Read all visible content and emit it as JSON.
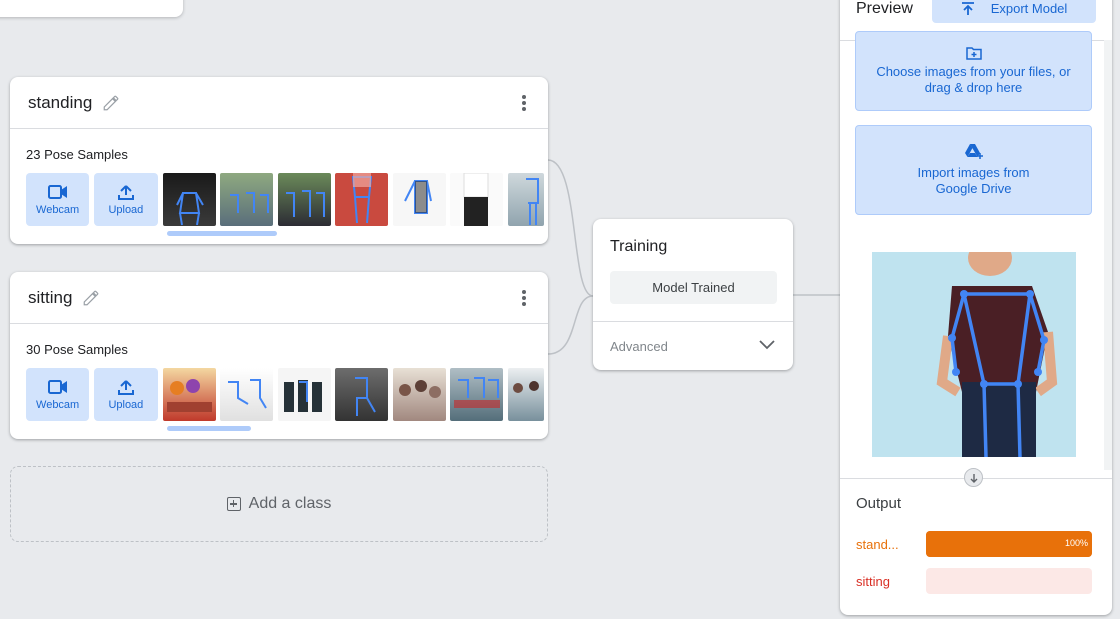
{
  "classes": [
    {
      "name": "standing",
      "samples_label": "23 Pose Samples",
      "webcam_label": "Webcam",
      "upload_label": "Upload"
    },
    {
      "name": "sitting",
      "samples_label": "30 Pose Samples",
      "webcam_label": "Webcam",
      "upload_label": "Upload"
    }
  ],
  "add_class_label": "Add a class",
  "training": {
    "title": "Training",
    "status_button": "Model Trained",
    "advanced_label": "Advanced"
  },
  "preview": {
    "title": "Preview",
    "export_label": "Export Model",
    "choose_files_text": "Choose images from your files, or drag & drop here",
    "import_drive_text": "Import images from Google Drive",
    "output_title": "Output",
    "outputs": [
      {
        "label": "stand...",
        "percent_text": "100%",
        "value": 1.0,
        "color": "#e8710a",
        "track": "#e8710a"
      },
      {
        "label": "sitting",
        "percent_text": "",
        "value": 0.0,
        "color": "#d93025",
        "track": "#fce8e6"
      }
    ]
  },
  "colors": {
    "accent_blue": "#1967d2",
    "button_bg": "#d2e3fc",
    "skeleton": "#4285f4",
    "background": "#e8eaed"
  },
  "icons": {
    "webcam": "webcam-icon",
    "upload": "upload-icon",
    "edit": "pencil-icon",
    "menu": "more-vert-icon",
    "expand": "chevron-down-icon",
    "export": "upload-arrow-icon",
    "folder": "folder-add-icon",
    "drive": "google-drive-icon",
    "down": "arrow-down-icon"
  }
}
